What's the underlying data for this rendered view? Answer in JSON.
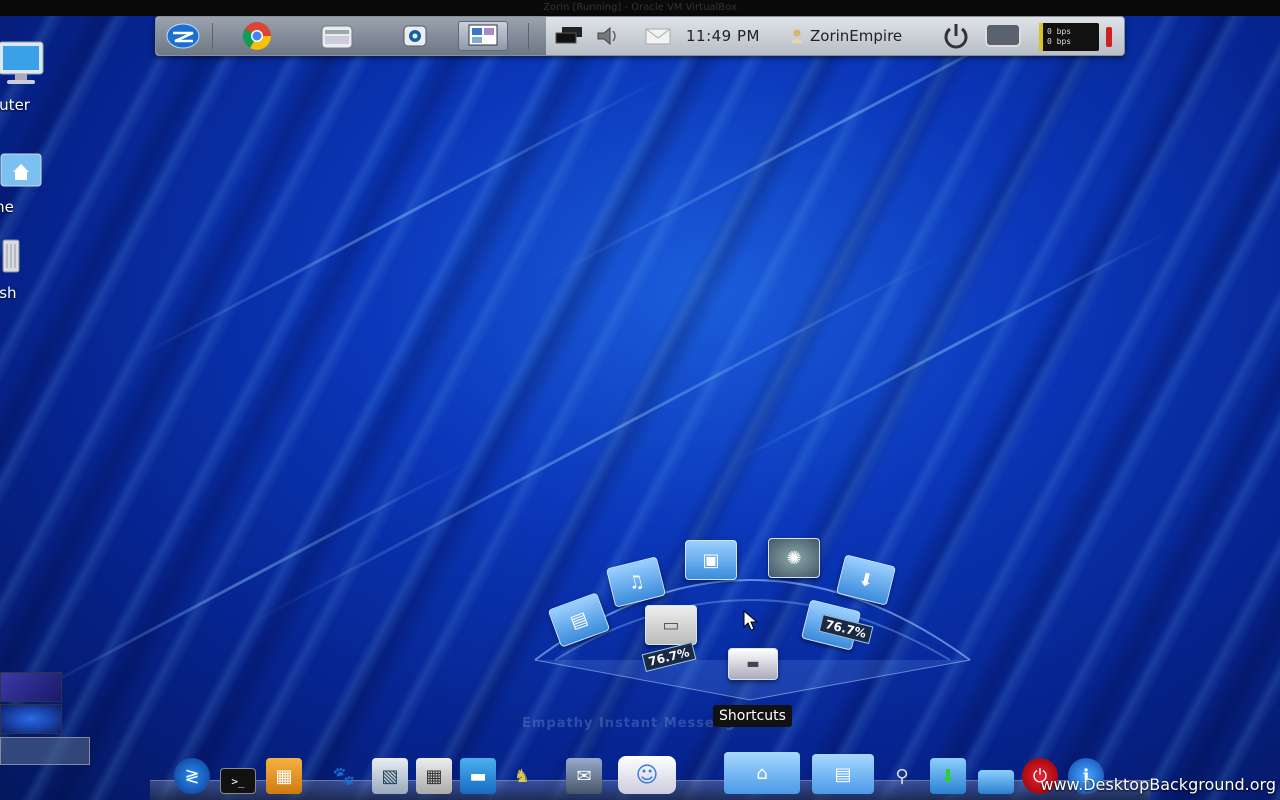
{
  "window": {
    "title": "Zorin [Running] - Oracle VM VirtualBox"
  },
  "top_panel": {
    "launchers": [
      {
        "name": "zorin-menu-icon"
      },
      {
        "name": "chrome-icon"
      },
      {
        "name": "file-manager-icon"
      },
      {
        "name": "camera-icon"
      },
      {
        "name": "desktop-switcher-icon"
      }
    ],
    "clock": "11:49 PM",
    "username": "ZorinEmpire",
    "netmon": {
      "up": "0 bps",
      "down": "0 bps"
    }
  },
  "desktop_icons": [
    {
      "label": "outer"
    },
    {
      "label": "me"
    },
    {
      "label": "ash"
    }
  ],
  "shortcuts": {
    "tooltip": "Shortcuts",
    "pct_left": "76.7%",
    "pct_right": "76.7%",
    "ghost_text": "Empathy Instant Messenger"
  },
  "watermark": "www.DesktopBackground.org",
  "colors": {
    "wallpaper": "#0a36b8",
    "panel": "#c8ced6"
  }
}
